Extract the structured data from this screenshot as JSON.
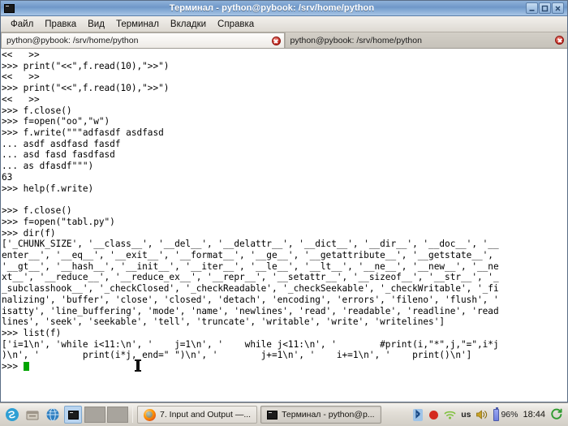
{
  "window": {
    "title": "Терминал - python@pybook: /srv/home/python",
    "icon": "terminal-icon",
    "controls": [
      {
        "name": "minimize",
        "glyph": "_"
      },
      {
        "name": "maximize",
        "glyph": "□"
      },
      {
        "name": "close",
        "glyph": "✕"
      }
    ]
  },
  "menubar": {
    "items": [
      {
        "label": "Файл"
      },
      {
        "label": "Правка"
      },
      {
        "label": "Вид"
      },
      {
        "label": "Терминал"
      },
      {
        "label": "Вкладки"
      },
      {
        "label": "Справка"
      }
    ]
  },
  "tabs": [
    {
      "label": "python@pybook: /srv/home/python",
      "active": true,
      "close_icon": "close-icon"
    },
    {
      "label": "python@pybook: /srv/home/python",
      "active": false,
      "close_icon": "close-icon"
    }
  ],
  "terminal": {
    "prompt": ">>>",
    "continuation": "...",
    "cursor_color": "#00a400",
    "background": "#ffffff",
    "foreground": "#000000",
    "lines": [
      "<<   >>",
      ">>> print(\"<<\",f.read(10),\">>\")",
      "<<   >>",
      ">>> print(\"<<\",f.read(10),\">>\")",
      "<<   >>",
      ">>> f.close()",
      ">>> f=open(\"oo\",\"w\")",
      ">>> f.write(\"\"\"adfasdf asdfasd",
      "... asdf asdfasd fasdf",
      "... asd fasd fasdfasd",
      "... as dfasdf\"\"\")",
      "63",
      ">>> help(f.write)",
      "",
      ">>> f.close()",
      ">>> f=open(\"tabl.py\")",
      ">>> dir(f)",
      "['_CHUNK_SIZE', '__class__', '__del__', '__delattr__', '__dict__', '__dir__', '__doc__', '__",
      "enter__', '__eq__', '__exit__', '__format__', '__ge__', '__getattribute__', '__getstate__',",
      "'__gt__', '__hash__', '__init__', '__iter__', '__le__', '__lt__', '__ne__', '__new__', '__ne",
      "xt__', '__reduce__', '__reduce_ex__', '__repr__', '__setattr__', '__sizeof__', '__str__', '_",
      "_subclasshook__', '_checkClosed', '_checkReadable', '_checkSeekable', '_checkWritable', '_fi",
      "nalizing', 'buffer', 'close', 'closed', 'detach', 'encoding', 'errors', 'fileno', 'flush', '",
      "isatty', 'line_buffering', 'mode', 'name', 'newlines', 'read', 'readable', 'readline', 'read",
      "lines', 'seek', 'seekable', 'tell', 'truncate', 'writable', 'write', 'writelines']",
      ">>> list(f)",
      "['i=1\\n', 'while i<11:\\n', '    j=1\\n', '    while j<11:\\n', '        #print(i,\"*\",j,\"=\",i*j",
      ")\\n', '        print(i*j, end=\" \")\\n', '        j+=1\\n', '    i+=1\\n', '    print()\\n']"
    ],
    "last_prompt": ">>>"
  },
  "taskbar": {
    "launchers": [
      {
        "name": "show-desktop-icon",
        "glyph": "S"
      },
      {
        "name": "file-manager-icon",
        "glyph": "▤"
      },
      {
        "name": "web-browser-icon",
        "glyph": "◉"
      },
      {
        "name": "terminal-launcher-icon",
        "glyph": "▪"
      }
    ],
    "pager": {
      "workspaces": 2,
      "active": 0
    },
    "windows": [
      {
        "label": "7. Input and Output —...",
        "icon": "firefox-icon",
        "active": false
      },
      {
        "label": "Терминал - python@p...",
        "icon": "terminal-icon",
        "active": true
      }
    ],
    "tray": {
      "bluetooth_icon": "bluetooth-icon",
      "record_icon": "record-indicator-icon",
      "network_icon": "wifi-icon",
      "keyboard_layout": "us",
      "volume_icon": "volume-icon",
      "battery_percent": "96%",
      "clock": "18:44",
      "power_icon": "power-icon"
    }
  }
}
